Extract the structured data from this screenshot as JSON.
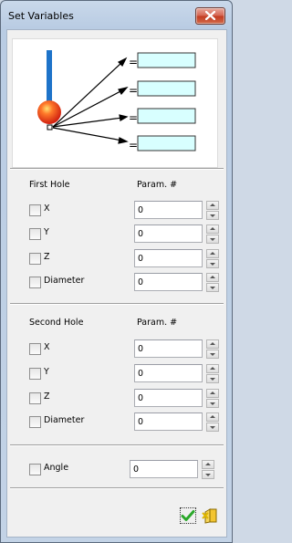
{
  "window": {
    "title": "Set Variables"
  },
  "diagram": {
    "equals": [
      "=",
      "=",
      "=",
      "="
    ]
  },
  "first_hole": {
    "label": "First Hole",
    "param_header": "Param. #",
    "rows": [
      {
        "label": "X",
        "checked": false,
        "value": "0"
      },
      {
        "label": "Y",
        "checked": false,
        "value": "0"
      },
      {
        "label": "Z",
        "checked": false,
        "value": "0"
      },
      {
        "label": "Diameter",
        "checked": false,
        "value": "0"
      }
    ]
  },
  "second_hole": {
    "label": "Second Hole",
    "param_header": "Param. #",
    "rows": [
      {
        "label": "X",
        "checked": false,
        "value": "0"
      },
      {
        "label": "Y",
        "checked": false,
        "value": "0"
      },
      {
        "label": "Z",
        "checked": false,
        "value": "0"
      },
      {
        "label": "Diameter",
        "checked": false,
        "value": "0"
      }
    ]
  },
  "angle": {
    "label": "Angle",
    "checked": false,
    "value": "0"
  },
  "buttons": {
    "ok_icon": "green-check-icon",
    "cancel_icon": "exit-door-icon"
  },
  "colors": {
    "box_fill": "#d8ffff",
    "ball": "#e8301a",
    "stem": "#1e73c9",
    "ok_green": "#2aa82a"
  }
}
